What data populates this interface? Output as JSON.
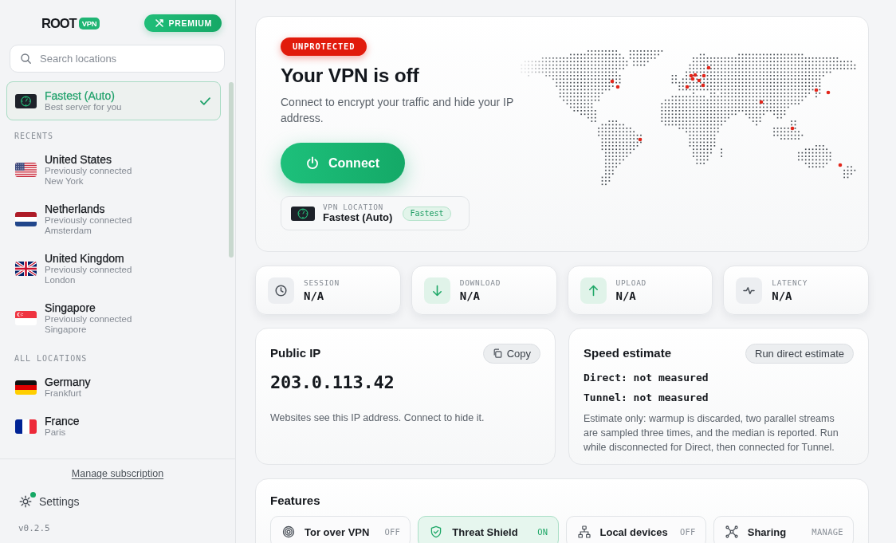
{
  "sidebar": {
    "logo": {
      "wordmark": "ROOT",
      "badge": "VPN"
    },
    "premium_button": "PREMIUM",
    "search": {
      "placeholder": "Search locations"
    },
    "fastest": {
      "kind": "fastest",
      "name": "Fastest (Auto)",
      "note": "Best server for you",
      "selected": true
    },
    "sections": [
      {
        "label": "RECENTS",
        "items": [
          {
            "kind": "us",
            "name": "United States",
            "note": "Previously connected",
            "city": "New York",
            "selected": false
          },
          {
            "kind": "nl",
            "name": "Netherlands",
            "note": "Previously connected",
            "city": "Amsterdam",
            "selected": false
          },
          {
            "kind": "gb",
            "name": "United Kingdom",
            "note": "Previously connected",
            "city": "London",
            "selected": false
          },
          {
            "kind": "sg",
            "name": "Singapore",
            "note": "Previously connected",
            "city": "Singapore",
            "selected": false
          }
        ]
      },
      {
        "label": "ALL LOCATIONS",
        "items": [
          {
            "kind": "de",
            "name": "Germany",
            "city": "Frankfurt",
            "selected": false
          },
          {
            "kind": "fr",
            "name": "France",
            "city": "Paris",
            "selected": false
          }
        ]
      }
    ],
    "manage_link": "Manage subscription",
    "settings": {
      "label": "Settings",
      "notification": true
    },
    "version": "v0.2.5"
  },
  "hero": {
    "status_badge": "UNPROTECTED",
    "protected": false,
    "title": "Your VPN is off",
    "subtitle": "Connect to encrypt your traffic and hide your IP address.",
    "connect_button": "Connect",
    "location": {
      "label": "VPN LOCATION",
      "name": "Fastest (Auto)",
      "tag": "Fastest"
    }
  },
  "stats": [
    {
      "kind": "session",
      "label": "SESSION",
      "value": "N/A"
    },
    {
      "kind": "download",
      "label": "DOWNLOAD",
      "value": "N/A"
    },
    {
      "kind": "upload",
      "label": "UPLOAD",
      "value": "N/A"
    },
    {
      "kind": "latency",
      "label": "LATENCY",
      "value": "N/A"
    }
  ],
  "public_ip": {
    "title": "Public IP",
    "copy_button": "Copy",
    "address": "203.0.113.42",
    "note": "Websites see this IP address. Connect to hide it."
  },
  "speed_estimate": {
    "title": "Speed estimate",
    "button": "Run direct estimate",
    "results": [
      "Direct: not measured",
      "Tunnel: not measured"
    ],
    "note": "Estimate only: warmup is discarded, two parallel streams are sampled three times, and the median is reported. Run while disconnected for Direct, then connected for Tunnel."
  },
  "features": {
    "title": "Features",
    "items": [
      {
        "kind": "tor",
        "label": "Tor over VPN",
        "status": "OFF",
        "on": false
      },
      {
        "kind": "shield",
        "label": "Threat Shield",
        "status": "ON",
        "on": true
      },
      {
        "kind": "local",
        "label": "Local devices",
        "status": "OFF",
        "on": false
      },
      {
        "kind": "sharing",
        "label": "Sharing",
        "status": "MANAGE",
        "on": false
      }
    ]
  }
}
